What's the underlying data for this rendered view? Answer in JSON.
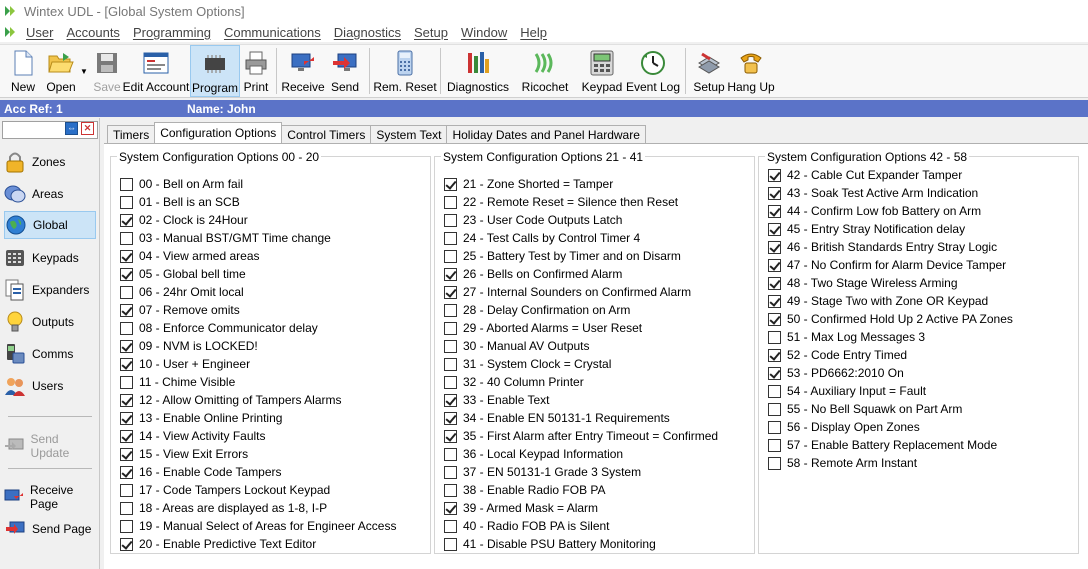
{
  "window": {
    "title": "Wintex UDL - [Global System Options]"
  },
  "menu": [
    "User",
    "Accounts",
    "Programming",
    "Communications",
    "Diagnostics",
    "Setup",
    "Window",
    "Help"
  ],
  "toolbar": {
    "new": "New",
    "open": "Open",
    "save": "Save",
    "edit_account": "Edit Account",
    "program": "Program",
    "print": "Print",
    "receive": "Receive",
    "send": "Send",
    "rem_reset": "Rem. Reset",
    "diagnostics": "Diagnostics",
    "ricochet": "Ricochet",
    "keypad": "Keypad",
    "event_log": "Event Log",
    "setup": "Setup",
    "hang_up": "Hang Up"
  },
  "account": {
    "ref": "Acc Ref: 1",
    "name": "Name: John"
  },
  "sidebar": {
    "items": [
      "Zones",
      "Areas",
      "Global",
      "Keypads",
      "Expanders",
      "Outputs",
      "Comms",
      "Users"
    ],
    "active": "Global",
    "send_update": "Send Update",
    "receive_page": "Receive Page",
    "send_page": "Send Page"
  },
  "tabs": [
    "Timers",
    "Configuration Options",
    "Control Timers",
    "System Text",
    "Holiday Dates and Panel Hardware"
  ],
  "active_tab": "Configuration Options",
  "groups": [
    {
      "title": "System Configuration Options 00 - 20",
      "options": [
        {
          "label": "00 - Bell on Arm fail",
          "checked": false
        },
        {
          "label": "01 - Bell is an SCB",
          "checked": false
        },
        {
          "label": "02 - Clock is 24Hour",
          "checked": true
        },
        {
          "label": "03 - Manual BST/GMT Time change",
          "checked": false
        },
        {
          "label": "04 - View armed areas",
          "checked": true
        },
        {
          "label": "05 - Global bell time",
          "checked": true
        },
        {
          "label": "06 - 24hr Omit local",
          "checked": false
        },
        {
          "label": "07 - Remove omits",
          "checked": true
        },
        {
          "label": "08 - Enforce Communicator delay",
          "checked": false
        },
        {
          "label": "09 - NVM is LOCKED!",
          "checked": true
        },
        {
          "label": "10 - User + Engineer",
          "checked": true
        },
        {
          "label": "11 - Chime Visible",
          "checked": false
        },
        {
          "label": "12 - Allow Omitting of Tampers Alarms",
          "checked": true
        },
        {
          "label": "13 - Enable Online Printing",
          "checked": true
        },
        {
          "label": "14 - View Activity Faults",
          "checked": true
        },
        {
          "label": "15 - View Exit Errors",
          "checked": true
        },
        {
          "label": "16 - Enable Code Tampers",
          "checked": true
        },
        {
          "label": "17 - Code Tampers Lockout Keypad",
          "checked": false
        },
        {
          "label": "18 - Areas are displayed as 1-8, I-P",
          "checked": false
        },
        {
          "label": "19 - Manual Select of Areas for Engineer Access",
          "checked": false
        },
        {
          "label": "20 - Enable Predictive Text Editor",
          "checked": true
        }
      ]
    },
    {
      "title": "System Configuration Options 21 - 41",
      "options": [
        {
          "label": "21 - Zone Shorted = Tamper",
          "checked": true
        },
        {
          "label": "22 - Remote Reset = Silence then Reset",
          "checked": false
        },
        {
          "label": "23 - User Code Outputs Latch",
          "checked": false
        },
        {
          "label": "24 - Test Calls by Control Timer 4",
          "checked": false
        },
        {
          "label": "25 - Battery Test by Timer and on Disarm",
          "checked": false
        },
        {
          "label": "26 - Bells on Confirmed Alarm",
          "checked": true
        },
        {
          "label": "27 - Internal Sounders on Confirmed Alarm",
          "checked": true
        },
        {
          "label": "28 - Delay Confirmation on Arm",
          "checked": false
        },
        {
          "label": "29 - Aborted Alarms = User Reset",
          "checked": false
        },
        {
          "label": "30 - Manual AV Outputs",
          "checked": false
        },
        {
          "label": "31 - System Clock = Crystal",
          "checked": false
        },
        {
          "label": "32 - 40 Column Printer",
          "checked": false
        },
        {
          "label": "33 - Enable Text",
          "checked": true
        },
        {
          "label": "34 - Enable EN 50131-1 Requirements",
          "checked": true
        },
        {
          "label": "35 - First Alarm after Entry Timeout = Confirmed",
          "checked": true
        },
        {
          "label": "36 - Local Keypad Information",
          "checked": false
        },
        {
          "label": "37 - EN 50131-1 Grade 3 System",
          "checked": false
        },
        {
          "label": "38 - Enable Radio FOB PA",
          "checked": false
        },
        {
          "label": "39 - Armed Mask = Alarm",
          "checked": true
        },
        {
          "label": "40 - Radio FOB PA is Silent",
          "checked": false
        },
        {
          "label": "41 - Disable PSU Battery Monitoring",
          "checked": false
        }
      ]
    },
    {
      "title": "System Configuration Options 42 - 58",
      "options": [
        {
          "label": "42 - Cable Cut Expander Tamper",
          "checked": true
        },
        {
          "label": "43 - Soak Test Active Arm Indication",
          "checked": true
        },
        {
          "label": "44 - Confirm Low fob Battery on Arm",
          "checked": true
        },
        {
          "label": "45 - Entry Stray Notification delay",
          "checked": true
        },
        {
          "label": "46 - British Standards Entry Stray Logic",
          "checked": true
        },
        {
          "label": "47 - No Confirm for Alarm Device Tamper",
          "checked": true
        },
        {
          "label": "48 - Two Stage Wireless Arming",
          "checked": true
        },
        {
          "label": "49 - Stage Two with Zone OR Keypad",
          "checked": true
        },
        {
          "label": "50 - Confirmed Hold Up 2 Active PA Zones",
          "checked": true
        },
        {
          "label": "51 - Max Log Messages 3",
          "checked": false
        },
        {
          "label": "52 - Code Entry Timed",
          "checked": true
        },
        {
          "label": "53 - PD6662:2010 On",
          "checked": true
        },
        {
          "label": "54 - Auxiliary Input = Fault",
          "checked": false
        },
        {
          "label": "55 - No Bell Squawk on Part Arm",
          "checked": false
        },
        {
          "label": "56 - Display Open Zones",
          "checked": false
        },
        {
          "label": "57 - Enable Battery Replacement Mode",
          "checked": false
        },
        {
          "label": "58 - Remote Arm Instant",
          "checked": false
        }
      ]
    }
  ]
}
